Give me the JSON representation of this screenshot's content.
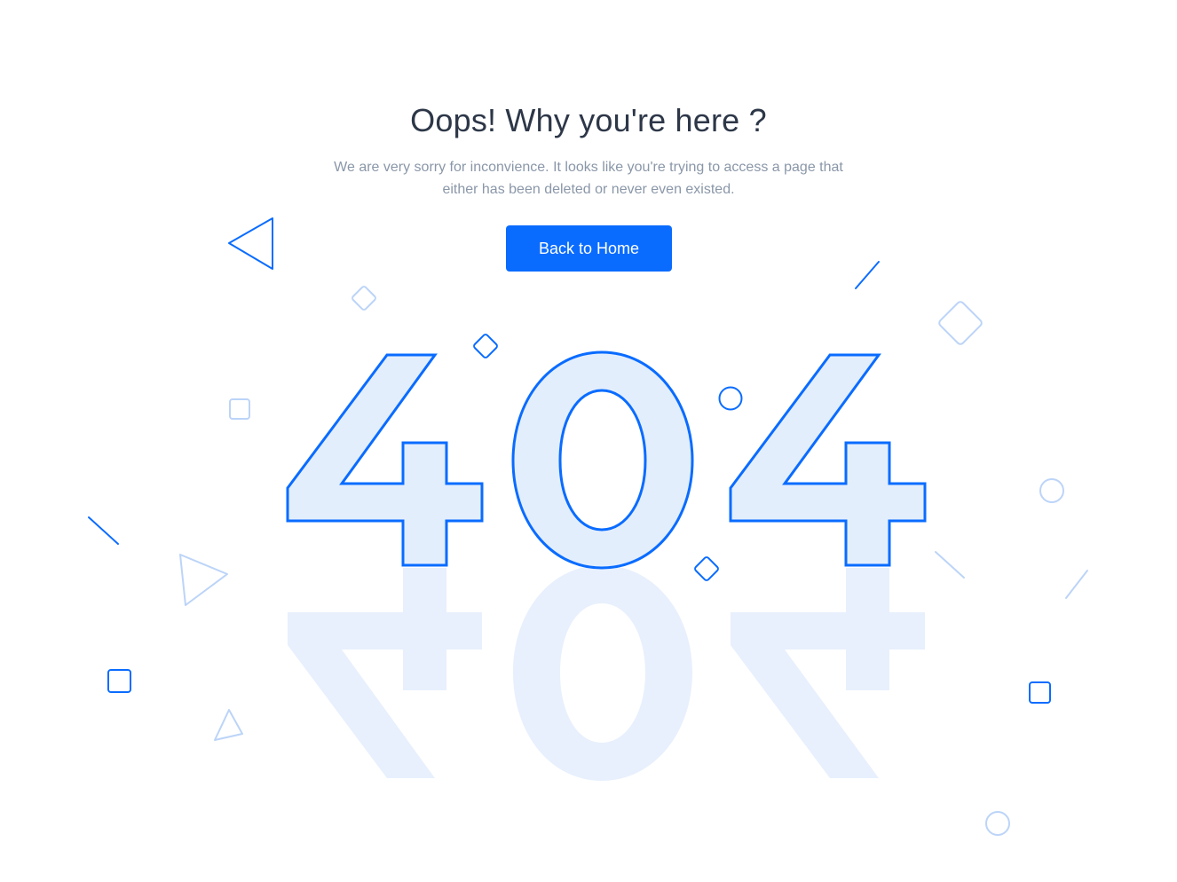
{
  "page": {
    "title": "Oops! Why you're here ?",
    "description": "We are very sorry for inconvience. It looks like you're trying to access a page that either has been deleted or never even existed.",
    "button_label": "Back to Home",
    "illustration_text": "404"
  },
  "colors": {
    "accent": "#0a6cff",
    "digit_fill": "#e3eefd",
    "title": "#2d3748",
    "muted_text": "#8a97a8",
    "shape_light": "#bcd4f8"
  },
  "icons": [
    "triangle-outline-icon",
    "diamond-outline-icon",
    "square-outline-icon",
    "circle-outline-icon",
    "line-dash-icon"
  ]
}
